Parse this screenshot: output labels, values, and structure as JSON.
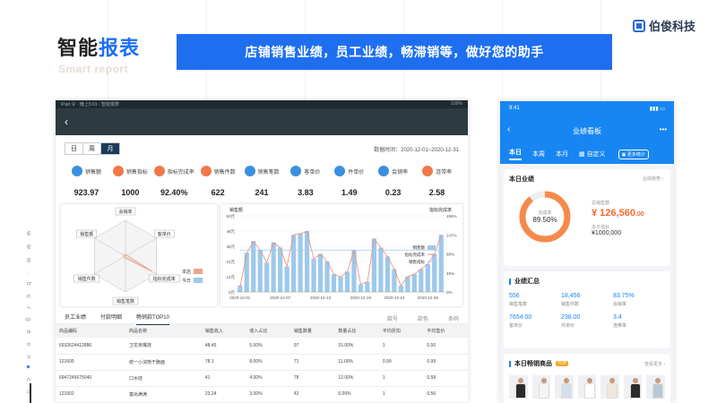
{
  "slide": {
    "title_a": "智能",
    "title_b": "报表",
    "subtitle": "Smart report",
    "banner": "店铺销售业绩，员工业绩，畅滞销等，做好您的助手",
    "brand": "伯俊科技",
    "side_url": "w w w . b u r g e o n . c n"
  },
  "web": {
    "status_left": "iPad 令 · 晚上5:01 · 智能报表",
    "status_right": "100%",
    "back_icon": "‹",
    "period_tabs": [
      "日",
      "周",
      "月"
    ],
    "active_period": 2,
    "date_label": "数据时间：2020-12-01~2020-12-31",
    "kpis": [
      {
        "label": "销售额",
        "value": "923.97",
        "icon": "bar-chart-icon",
        "color": "#3b8fe0"
      },
      {
        "label": "销售指标",
        "value": "1000",
        "icon": "target-icon",
        "color": "#f0784a"
      },
      {
        "label": "指标完成率",
        "value": "92.40%",
        "icon": "flag-icon",
        "color": "#f0784a"
      },
      {
        "label": "销售件数",
        "value": "622",
        "icon": "box-icon",
        "color": "#f0784a"
      },
      {
        "label": "销售笔数",
        "value": "241",
        "icon": "trend-icon",
        "color": "#3b8fe0"
      },
      {
        "label": "客单价",
        "value": "3.83",
        "icon": "person-icon",
        "color": "#3b8fe0"
      },
      {
        "label": "件单价",
        "value": "1.49",
        "icon": "tag-icon",
        "color": "#3b8fe0"
      },
      {
        "label": "会销率",
        "value": "0.23",
        "icon": "member-icon",
        "color": "#3b8fe0"
      },
      {
        "label": "连带率",
        "value": "2.58",
        "icon": "link-icon",
        "color": "#f0784a"
      }
    ],
    "radar": {
      "axes": [
        "会销率",
        "客单价",
        "指标完成率",
        "销售笔数",
        "销售件数",
        "销售额"
      ],
      "series": [
        {
          "name": "本店",
          "color": "#f0a28a",
          "values": [
            0.05,
            0.05,
            0.85,
            0.05,
            0.05,
            0.05
          ]
        },
        {
          "name": "今日",
          "color": "#9ec9ec",
          "values": [
            0.0,
            0.0,
            0.0,
            0.0,
            0.0,
            0.0
          ]
        }
      ]
    },
    "table_tabs": [
      "员工业绩",
      "付款明细",
      "畅销款TOP10"
    ],
    "active_table_tab": 2,
    "table_right_tabs": [
      "款号",
      "款色",
      "条码"
    ],
    "table_headers": [
      "商品编码",
      "商品名称",
      "销售收入",
      "收入占比",
      "销售数量",
      "数量占比",
      "平均折扣",
      "平均售价"
    ],
    "table_rows": [
      [
        "6932624412886",
        "卫龙亲嘴烧",
        "48.45",
        "5.00%",
        "97",
        "15.00%",
        "1",
        "0.50"
      ],
      [
        "121605",
        "统一小浣熊干脆面",
        "78.1",
        "8.00%",
        "71",
        "11.00%",
        "0.99",
        "0.99"
      ],
      [
        "6947245675040",
        "口水娃",
        "41",
        "4.00%",
        "78",
        "12.00%",
        "1",
        "0.58"
      ],
      [
        "121602",
        "童尚满满",
        "23.24",
        "3.00%",
        "42",
        "6.00%",
        "1",
        "0.56"
      ]
    ]
  },
  "chart_data": {
    "type": "bar",
    "ylabel": "销售额",
    "y2label": "指标完成率",
    "ylim": [
      0,
      60
    ],
    "y2lim": [
      0,
      196
    ],
    "ytick_labels": [
      "0元",
      "12元",
      "24元",
      "36元",
      "48元",
      "60元"
    ],
    "y2tick_labels": [
      "0%",
      "49%",
      "98%",
      "147%",
      "196%"
    ],
    "xtick_labels": [
      "2020-12-01",
      "2020-12-07",
      "2020-12-13",
      "2020-12-19",
      "2020-12-24",
      "2020-12-29"
    ],
    "series": [
      {
        "name": "销售额",
        "type": "bar",
        "color": "#9ec9ec",
        "values": [
          5,
          31,
          40,
          33,
          23,
          39,
          35,
          20,
          45,
          46,
          48,
          26,
          30,
          24,
          14,
          12,
          16,
          33,
          6,
          8,
          42,
          35,
          28,
          18,
          5,
          12,
          14,
          18,
          22,
          30,
          45
        ]
      },
      {
        "name": "指标完成率",
        "type": "line",
        "color": "#f08a78",
        "values": [
          12,
          99,
          130,
          108,
          75,
          127,
          114,
          66,
          147,
          150,
          156,
          85,
          98,
          78,
          46,
          39,
          52,
          108,
          20,
          26,
          137,
          114,
          91,
          59,
          16,
          39,
          46,
          59,
          72,
          98,
          147
        ]
      },
      {
        "name": "销售指标",
        "type": "line",
        "color": "#9ec9ec",
        "values": [
          33,
          33,
          33,
          33,
          33,
          33,
          33,
          33,
          33,
          33,
          33,
          33,
          33,
          33,
          33,
          33,
          33,
          33,
          33,
          33,
          33,
          33,
          33,
          33,
          33,
          33,
          33,
          33,
          33,
          33,
          33
        ]
      }
    ]
  },
  "phone": {
    "time": "9:41",
    "title": "业绩看板",
    "back_icon": "‹",
    "more_icon": "•••",
    "tabs": [
      "本日",
      "本周",
      "本月"
    ],
    "active_tab": 0,
    "custom_label": "自定义",
    "switch_btn": "更多统计",
    "today": {
      "title": "本日业绩",
      "link": "业绩趋势 ›",
      "rate_label": "完成率",
      "rate_value": "89.50%",
      "rate_fraction": 0.895,
      "total_label": "总销售额",
      "total_value": "¥ 126,560",
      "total_unit": ".00",
      "target_label": "本日指标",
      "target_value": "¥1000,000"
    },
    "summary": {
      "title": "业绩汇总",
      "cells": [
        {
          "value": "556",
          "label": "销售笔数"
        },
        {
          "value": "18,456",
          "label": "销售件数"
        },
        {
          "value": "83.75%",
          "label": "会销率"
        },
        {
          "value": "7654.00",
          "label": "客单价"
        },
        {
          "value": "238.00",
          "label": "件单价"
        },
        {
          "value": "3.4",
          "label": "连带率"
        }
      ]
    },
    "hot": {
      "title": "本日畅销商品",
      "badge": "TOP",
      "link": "查看更多 ›",
      "thumb_colors": [
        "#2b2b2b",
        "#f4f4f4",
        "#d6dfe9",
        "#ffffff",
        "#efe7dd",
        "#2b2b2b",
        "#b9c7d6"
      ]
    }
  }
}
